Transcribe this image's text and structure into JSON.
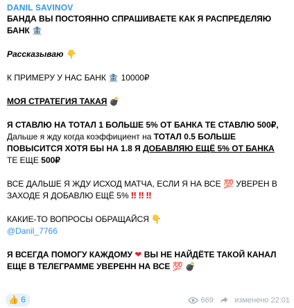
{
  "message": {
    "author": "DANIL SAVINOV",
    "line1": "БАНДА ВЫ ПОСТОЯННО СПРАШИВАЕТЕ КАК Я РАСПРЕДЕЛЯЮ",
    "line2": "БАНК",
    "line3": "Рассказываю",
    "line4_a": "К ПРИМЕРУ У НАС БАНК",
    "line4_b": "10000₽",
    "line5": "МОЯ СТРАТЕГИЯ ТАКАЯ",
    "line6": "Я СТАВЛЮ НА ТОТАЛ 1 БОЛЬШЕ 5% ОТ БАНКА ТЕ СТАВЛЮ 500₽,",
    "line7_a": "Дальше я жду когда коэффициент на ",
    "line7_b": "ТОТАЛ 0.5 БОЛЬШЕ",
    "line8_a": "ПОВЫСИТСЯ ХОТЯ БЫ НА 1.8 Я ",
    "line8_b": "ДОБАВЛЯЮ ЕЩЁ 5% ОТ БАНКА",
    "line9_a": "ТЕ ЕЩЕ ",
    "line9_b": "500₽",
    "line10_a": "ВСЕ ДАЛЬШЕ Я ЖДУ ИСХОД МАТЧА, ЕСЛИ Я НА ВСЕ",
    "line10_b": "УВЕРЕН В",
    "line11": "ЗАХОДЕ Я ДОБАВЛЮ ЕЩЁ 5%",
    "line12": "КАКИЕ-ТО ВОПРОСЫ ОБРАЩАЙСЯ",
    "line13": "@Danil_7766",
    "line14_a": "Я ВСЕГДА ПОМОГУ КАЖДОМУ",
    "line14_b": "ВЫ НЕ НАЙДЁТЕ ТАКОЙ КАНАЛ",
    "line15": "ЕЩЕ В ТЕЛЕГРАММЕ УВЕРЕНН НА ВСЕ"
  },
  "icons": {
    "bank": "🏦",
    "point_down": "👇",
    "bomb": "💣",
    "hundred": "💯",
    "double_exclaim": "‼",
    "heart": "❤",
    "thumbs_up": "👍"
  },
  "footer": {
    "reaction_count": "6",
    "views": "669",
    "edited": "изменено 22:01"
  },
  "colors": {
    "accent": "#3390ec",
    "meta": "#a0acb6",
    "exclaim": "#e0242d"
  }
}
